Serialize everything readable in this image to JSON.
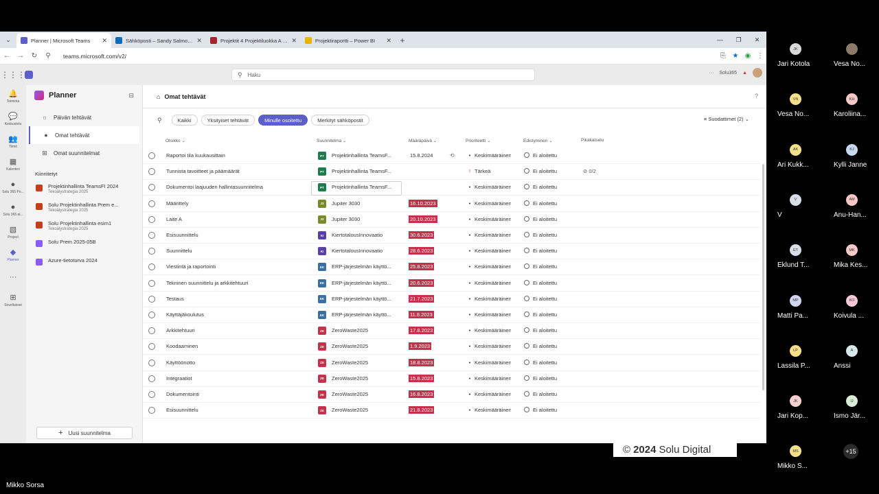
{
  "browser": {
    "tabs": [
      {
        "title": "Planner | Microsoft Teams",
        "color": "#5b5fc7"
      },
      {
        "title": "Sähköposti – Sandy Salmon – O",
        "color": "#0f6cbd"
      },
      {
        "title": "Projektit 4 Projektiluokka A (St",
        "color": "#a4262c"
      },
      {
        "title": "Projektiraportti – Power BI",
        "color": "#e8b600"
      }
    ],
    "url": "teams.microsoft.com/v2/"
  },
  "teams": {
    "search_placeholder": "Haku",
    "tenant": "Solu365"
  },
  "rail": [
    {
      "label": "Toiminta",
      "icon": "bell-icon",
      "glyph": "🔔"
    },
    {
      "label": "Keskustelu",
      "icon": "chat-icon",
      "glyph": "💬"
    },
    {
      "label": "Tiimit",
      "icon": "teams-icon",
      "glyph": "👥"
    },
    {
      "label": "Kalenteri",
      "icon": "calendar-icon",
      "glyph": "▦"
    },
    {
      "label": "Solu 365 Po...",
      "icon": "app-icon",
      "glyph": "●"
    },
    {
      "label": "Solu 365 al...",
      "icon": "app-icon",
      "glyph": "●"
    },
    {
      "label": "Project",
      "icon": "project-icon",
      "glyph": "▧"
    },
    {
      "label": "Planner",
      "icon": "planner-icon",
      "glyph": "◆"
    },
    {
      "label": "...",
      "icon": "more-icon",
      "glyph": ""
    },
    {
      "label": "Sovellukset",
      "icon": "apps-icon",
      "glyph": "⊞"
    }
  ],
  "sidebar": {
    "title": "Planner",
    "nav": [
      {
        "label": "Päivän tehtävät",
        "icon": "sun-icon",
        "glyph": "☼"
      },
      {
        "label": "Omat tehtävät",
        "icon": "person-icon",
        "glyph": "●"
      },
      {
        "label": "Omat suunnitelmat",
        "icon": "grid-icon",
        "glyph": "⊞"
      }
    ],
    "pinned_label": "Kiinnitetyt",
    "pinned": [
      {
        "title": "Projektinhallinta TeamsFI 2024",
        "sub": "Tekoälystrategia 2025",
        "color": "#c43e1c"
      },
      {
        "title": "Solu Projektinhallinta Prem e...",
        "sub": "Tekoälystrategia 2025",
        "color": "#c43e1c"
      },
      {
        "title": "Solu Projektinhallinta esim1",
        "sub": "Tekoälystrategia 2025",
        "color": "#c43e1c"
      },
      {
        "title": "Solu Prem 2025-05B",
        "sub": "",
        "color": "#8b5cf6"
      },
      {
        "title": "Azure-tietoturva 2024",
        "sub": "",
        "color": "#8b5cf6"
      }
    ],
    "new_plan": "Uusi suunnitelma"
  },
  "main": {
    "title": "Omat tehtävät",
    "filters": [
      "Kaikki",
      "Yksityiset tehtävät",
      "Minulle osoitettu",
      "Merkityt sähköpostit"
    ],
    "filter_selected": 2,
    "filter_count": "Suodattimet (2)",
    "columns": [
      "Otsikko",
      "Suunnitelma",
      "Määräpäivä",
      "Prioriteetti",
      "Edistyminen",
      "Pikakatselu"
    ]
  },
  "tasks": [
    {
      "title": "Raportoi tila kuukausittain",
      "badge": "PT",
      "plan": "Projektinhallinta TeamsF...",
      "due": "15.8.2024",
      "late": false,
      "prio": "Keskimääräinen",
      "bullet": "•",
      "prog": "Ei aloitettu",
      "check": "",
      "color": "#1e7b4b"
    },
    {
      "title": "Tunnista tavoitteet ja päämäärät",
      "badge": "PT",
      "plan": "Projektinhallinta TeamsF...",
      "due": "",
      "late": false,
      "prio": "Tärkeä",
      "bullet": "!",
      "prog": "Ei aloitettu",
      "check": "0/2",
      "color": "#1e7b4b"
    },
    {
      "title": "Dokumentoi laajuuden hallintasuunnitelma",
      "badge": "PT",
      "plan": "Projektinhallinta TeamsF...",
      "due": "",
      "late": false,
      "prio": "Keskimääräinen",
      "bullet": "•",
      "prog": "Ei aloitettu",
      "check": "",
      "color": "#1e7b4b"
    },
    {
      "title": "Määrittely",
      "badge": "J3",
      "plan": "Jupiter 3030",
      "due": "16.10.2023",
      "late": true,
      "prio": "Keskimääräinen",
      "bullet": "•",
      "prog": "Ei aloitettu",
      "check": "",
      "color": "#7a8a2a"
    },
    {
      "title": "Laite A",
      "badge": "J3",
      "plan": "Jupiter 3030",
      "due": "20.10.2023",
      "late": true,
      "prio": "Keskimääräinen",
      "bullet": "•",
      "prog": "Ei aloitettu",
      "check": "",
      "color": "#7a8a2a"
    },
    {
      "title": "Esisuunnittelu",
      "badge": "KI",
      "plan": "KiertotalousInnovaatio",
      "due": "30.6.2023",
      "late": true,
      "prio": "Keskimääräinen",
      "bullet": "•",
      "prog": "Ei aloitettu",
      "check": "",
      "color": "#5b3fa8"
    },
    {
      "title": "Suunnittelu",
      "badge": "KI",
      "plan": "KiertotalousInnovaatio",
      "due": "28.6.2023",
      "late": true,
      "prio": "Keskimääräinen",
      "bullet": "•",
      "prog": "Ei aloitettu",
      "check": "",
      "color": "#5b3fa8"
    },
    {
      "title": "Viestintä ja raportointi",
      "badge": "EK",
      "plan": "ERP-järjestelmän käyttö...",
      "due": "25.8.2023",
      "late": true,
      "prio": "Keskimääräinen",
      "bullet": "•",
      "prog": "Ei aloitettu",
      "check": "",
      "color": "#3a6ea5"
    },
    {
      "title": "Tekninen suunnittelu ja arkkitehtuuri",
      "badge": "EK",
      "plan": "ERP-järjestelmän käyttö...",
      "due": "20.6.2023",
      "late": true,
      "prio": "Keskimääräinen",
      "bullet": "•",
      "prog": "Ei aloitettu",
      "check": "",
      "color": "#3a6ea5"
    },
    {
      "title": "Testaus",
      "badge": "EK",
      "plan": "ERP-järjestelmän käyttö...",
      "due": "21.7.2023",
      "late": true,
      "prio": "Keskimääräinen",
      "bullet": "•",
      "prog": "Ei aloitettu",
      "check": "",
      "color": "#3a6ea5"
    },
    {
      "title": "Käyttäjäkoulutus",
      "badge": "EK",
      "plan": "ERP-järjestelmän käyttö...",
      "due": "11.8.2023",
      "late": true,
      "prio": "Keskimääräinen",
      "bullet": "•",
      "prog": "Ei aloitettu",
      "check": "",
      "color": "#3a6ea5"
    },
    {
      "title": "Arkkitehtuuri",
      "badge": "ZE",
      "plan": "ZeroWaste2025",
      "due": "17.8.2023",
      "late": true,
      "prio": "Keskimääräinen",
      "bullet": "•",
      "prog": "Ei aloitettu",
      "check": "",
      "color": "#c4314b"
    },
    {
      "title": "Koodaaminen",
      "badge": "ZE",
      "plan": "ZeroWaste2025",
      "due": "1.9.2023",
      "late": true,
      "prio": "Keskimääräinen",
      "bullet": "•",
      "prog": "Ei aloitettu",
      "check": "",
      "color": "#c4314b"
    },
    {
      "title": "Käyttöönotto",
      "badge": "ZE",
      "plan": "ZeroWaste2025",
      "due": "18.8.2023",
      "late": true,
      "prio": "Keskimääräinen",
      "bullet": "•",
      "prog": "Ei aloitettu",
      "check": "",
      "color": "#c4314b"
    },
    {
      "title": "Integraatiot",
      "badge": "ZE",
      "plan": "ZeroWaste2025",
      "due": "15.8.2023",
      "late": true,
      "prio": "Keskimääräinen",
      "bullet": "•",
      "prog": "Ei aloitettu",
      "check": "",
      "color": "#c4314b"
    },
    {
      "title": "Dokumentointi",
      "badge": "ZE",
      "plan": "ZeroWaste2025",
      "due": "16.8.2023",
      "late": true,
      "prio": "Keskimääräinen",
      "bullet": "•",
      "prog": "Ei aloitettu",
      "check": "",
      "color": "#c4314b"
    },
    {
      "title": "Esisuunnittelu",
      "badge": "ZE",
      "plan": "ZeroWaste2025",
      "due": "21.8.2023",
      "late": true,
      "prio": "Keskimääräinen",
      "bullet": "•",
      "prog": "Ei aloitettu",
      "check": "",
      "color": "#c4314b"
    }
  ],
  "new_row": {
    "placeholder": "Otsikko",
    "badge": "PT",
    "plan": "Projektinhallinta TeamsF...",
    "due": "Määräpäivä",
    "prio": "Keskimääräinen",
    "prog": "Ei aloitettu",
    "check": "Pikakatselu",
    "color": "#1e7b4b"
  },
  "watermark": {
    "symbol": "©",
    "year": "2024",
    "org": "Solu Digital"
  },
  "participants": [
    {
      "initials": "JK",
      "name": "Jari Kotola",
      "bg": "#d9d9d9"
    },
    {
      "initials": "",
      "name": "Vesa No...",
      "bg": "#8a7a6a"
    },
    {
      "initials": "VN",
      "name": "Vesa No...",
      "bg": "#f5e08a"
    },
    {
      "initials": "KH",
      "name": "Karoliina...",
      "bg": "#f8c8c8"
    },
    {
      "initials": "AK",
      "name": "Ari Kukk...",
      "bg": "#f5e08a"
    },
    {
      "initials": "KJ",
      "name": "Kylli Janne",
      "bg": "#c8d8f0"
    },
    {
      "initials": "V",
      "name": "V",
      "bg": "#d8dde8"
    },
    {
      "initials": "AM",
      "name": "Anu-Han...",
      "bg": "#f8c8c8"
    },
    {
      "initials": "ET",
      "name": "Eklund T...",
      "bg": "#d8dde8"
    },
    {
      "initials": "MK",
      "name": "Mika Kes...",
      "bg": "#f8c8c8"
    },
    {
      "initials": "MP",
      "name": "Matti Pa...",
      "bg": "#d0d4f0"
    },
    {
      "initials": "KO",
      "name": "Koivula ...",
      "bg": "#f8c8d8"
    },
    {
      "initials": "LP",
      "name": "Lassila P...",
      "bg": "#f5e08a"
    },
    {
      "initials": "A",
      "name": "Anssi",
      "bg": "#d8e8e8"
    },
    {
      "initials": "JK",
      "name": "Jari Kop...",
      "bg": "#f8d0d0"
    },
    {
      "initials": "IJ",
      "name": "Ismo Jär...",
      "bg": "#d8ecd8"
    },
    {
      "initials": "MS",
      "name": "Mikko S...",
      "bg": "#f5e08a"
    },
    {
      "initials": "+15",
      "name": "",
      "bg": "#2a2a2a"
    }
  ],
  "speaker": "Mikko Sorsa"
}
